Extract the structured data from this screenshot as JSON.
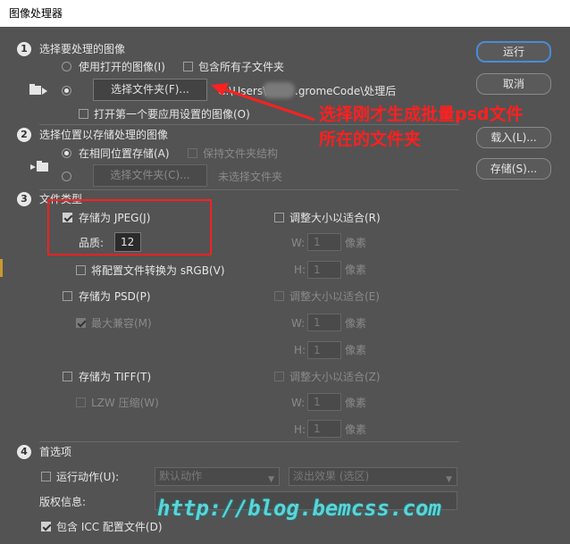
{
  "window": {
    "title": "图像处理器"
  },
  "buttons": {
    "run": "运行",
    "cancel": "取消",
    "load": "载入(L)...",
    "save": "存储(S)..."
  },
  "section1": {
    "number": "1",
    "title": "选择要处理的图像",
    "use_open_images": "使用打开的图像(I)",
    "include_subfolders": "包含所有子文件夹",
    "select_folder": "选择文件夹(F)...",
    "path_prefix": "C:\\Users\\",
    "path_suffix": ".gromeCode\\处理后",
    "open_first_image": "打开第一个要应用设置的图像(O)"
  },
  "section2": {
    "number": "2",
    "title": "选择位置以存储处理的图像",
    "same_location": "在相同位置存储(A)",
    "keep_structure": "保持文件夹结构",
    "select_folder": "选择文件夹(C)...",
    "no_folder": "未选择文件夹"
  },
  "section3": {
    "number": "3",
    "title": "文件类型",
    "jpeg": {
      "save_as": "存储为 JPEG(J)",
      "quality_label": "品质:",
      "quality_value": "12",
      "resize": "调整大小以适合(R)",
      "w_label": "W:",
      "h_label": "H:",
      "w_value": "1",
      "h_value": "1",
      "unit": "像素",
      "convert_srgb": "将配置文件转换为 sRGB(V)"
    },
    "psd": {
      "save_as": "存储为 PSD(P)",
      "max_compat": "最大兼容(M)",
      "resize": "调整大小以适合(E)",
      "w_label": "W:",
      "h_label": "H:",
      "w_value": "1",
      "h_value": "1",
      "unit": "像素"
    },
    "tiff": {
      "save_as": "存储为 TIFF(T)",
      "lzw": "LZW 压缩(W)",
      "resize": "调整大小以适合(Z)",
      "w_label": "W:",
      "h_label": "H:",
      "w_value": "1",
      "h_value": "1",
      "unit": "像素"
    }
  },
  "section4": {
    "number": "4",
    "title": "首选项",
    "run_action": "运行动作(U):",
    "action_set": "默认动作",
    "action": "淡出效果 (选区)",
    "copyright_label": "版权信息:",
    "copyright_value": "",
    "include_icc": "包含 ICC 配置文件(D)"
  },
  "annotation": {
    "line1": "选择刚才生成批量psd文件",
    "line2": "所在的文件夹"
  },
  "watermark": "http://blog.bemcss.com",
  "colors": {
    "annotation": "#ff2020",
    "primary_border": "#4a8bd8",
    "watermark": "#5fd3d6"
  }
}
